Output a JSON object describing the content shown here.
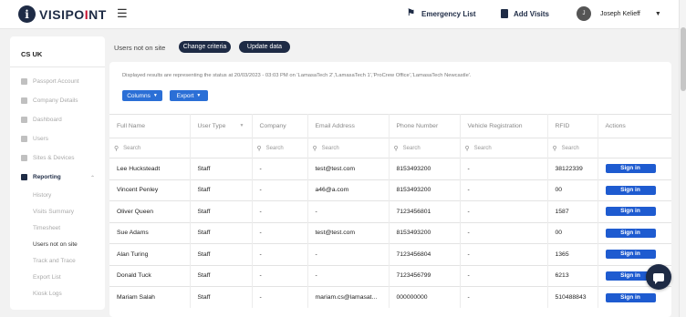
{
  "brand": {
    "mark": "i",
    "name_main": "VISIPO",
    "name_red": "I",
    "name_end": "NT"
  },
  "topbar": {
    "menu_icon": "hamburger-icon",
    "emergency_label": "Emergency List",
    "add_visits_label": "Add Visits",
    "user_initial": "J",
    "user_name": "Joseph Kelieff"
  },
  "sidebar": {
    "org": "CS UK",
    "items": [
      {
        "label": "Passport Account",
        "icon": "passport-icon"
      },
      {
        "label": "Company Details",
        "icon": "building-icon"
      },
      {
        "label": "Dashboard",
        "icon": "home-icon"
      },
      {
        "label": "Users",
        "icon": "users-icon"
      },
      {
        "label": "Sites & Devices",
        "icon": "devices-icon"
      },
      {
        "label": "Reporting",
        "icon": "report-icon"
      }
    ],
    "sub_items": [
      "History",
      "Visits Summary",
      "Timesheet",
      "Users not on site",
      "Track and Trace",
      "Export List",
      "Kiosk Logs"
    ]
  },
  "header": {
    "page_label": "Users not on site",
    "change_criteria": "Change criteria",
    "update_data": "Update data"
  },
  "report": {
    "status_text": "Displayed results are representing the status at 20/03/2023 - 03:03 PM on 'LamasaTech 2','LamasaTech 1','ProCrew Office','LamasaTech Newcastle'.",
    "columns_btn": "Columns",
    "export_btn": "Export",
    "search_placeholder": "Search",
    "columns": [
      "Full Name",
      "User Type",
      "Company",
      "Email Address",
      "Phone Number",
      "Vehicle Registration",
      "RFID",
      "Actions"
    ],
    "action_label": "Sign in",
    "rows": [
      [
        "Lee Hucksteadt",
        "Staff",
        "-",
        "test@test.com",
        "8153493200",
        "-",
        "38122339"
      ],
      [
        "Vincent Penley",
        "Staff",
        "-",
        "a46@a.com",
        "8153493200",
        "-",
        "00"
      ],
      [
        "Oliver Queen",
        "Staff",
        "-",
        "-",
        "7123456801",
        "-",
        "1587"
      ],
      [
        "Sue Adams",
        "Staff",
        "-",
        "test@test.com",
        "8153493200",
        "-",
        "00"
      ],
      [
        "Alan Turing",
        "Staff",
        "-",
        "-",
        "7123456804",
        "-",
        "1365"
      ],
      [
        "Donald Tuck",
        "Staff",
        "-",
        "-",
        "7123456799",
        "-",
        "6213"
      ],
      [
        "Mariam Salah",
        "Staff",
        "-",
        "mariam.cs@lamasat...",
        "000000000",
        "-",
        "510488843"
      ]
    ]
  },
  "colors": {
    "navy": "#1e2b45",
    "blue": "#2b6fd6",
    "signin": "#1e5bd0",
    "brand_red": "#c8102e"
  }
}
